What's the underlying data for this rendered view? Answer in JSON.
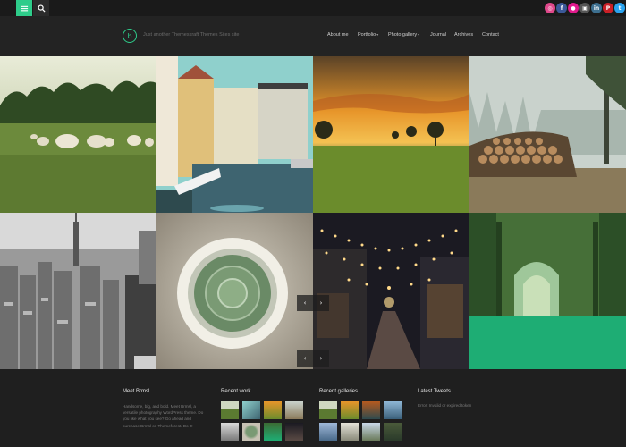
{
  "topbar": {
    "menu_icon": "hamburger-icon",
    "search_icon": "search-icon",
    "accent": "#2ecc8a",
    "social": [
      {
        "icon": "dribbble-icon",
        "glyph": "◎",
        "color": "#e0488b"
      },
      {
        "icon": "facebook-icon",
        "glyph": "f",
        "color": "#3b5998"
      },
      {
        "icon": "flickr-icon",
        "glyph": "●",
        "color": "#e01a8c"
      },
      {
        "icon": "instagram-icon",
        "glyph": "▣",
        "color": "#555555"
      },
      {
        "icon": "linkedin-icon",
        "glyph": "in",
        "color": "#3d6f8f"
      },
      {
        "icon": "pinterest-icon",
        "glyph": "P",
        "color": "#cb2027"
      },
      {
        "icon": "twitter-icon",
        "glyph": "t",
        "color": "#2aa3ef"
      },
      {
        "icon": "youtube-icon",
        "glyph": "▶",
        "color": "#e52d27"
      }
    ]
  },
  "header": {
    "logo_letter": "b",
    "tagline": "Just another Themeskraft Themes Sites site",
    "nav": [
      {
        "label": "About me",
        "dropdown": false
      },
      {
        "label": "Portfolio",
        "dropdown": true
      },
      {
        "label": "Photo gallery",
        "dropdown": true
      },
      {
        "label": "Journal",
        "dropdown": false
      },
      {
        "label": "Archives",
        "dropdown": false
      },
      {
        "label": "Contact",
        "dropdown": false
      }
    ],
    "dropdown_caret": "▾"
  },
  "gallery": {
    "arrow_prev": "‹",
    "arrow_next": "›",
    "photos": [
      "sheep-meadow",
      "canal-houses",
      "sunset-field",
      "log-pile-fog",
      "city-skyline",
      "cactus-pot",
      "night-street-lights",
      "green-tree-tunnel"
    ]
  },
  "footer": {
    "about": {
      "title": "Meet Brmsl",
      "text": "Handsome, big, and bold. Meet Brmsl, a versatile photography WordPress theme. Do you like what you see? Go ahead and purchase Brmsl on Themeforest. Do it!"
    },
    "recent_work": {
      "title": "Recent work"
    },
    "recent_galleries": {
      "title": "Recent galleries"
    },
    "latest_tweets": {
      "title": "Latest Tweets",
      "text": "Error: Invalid or expired token"
    }
  }
}
